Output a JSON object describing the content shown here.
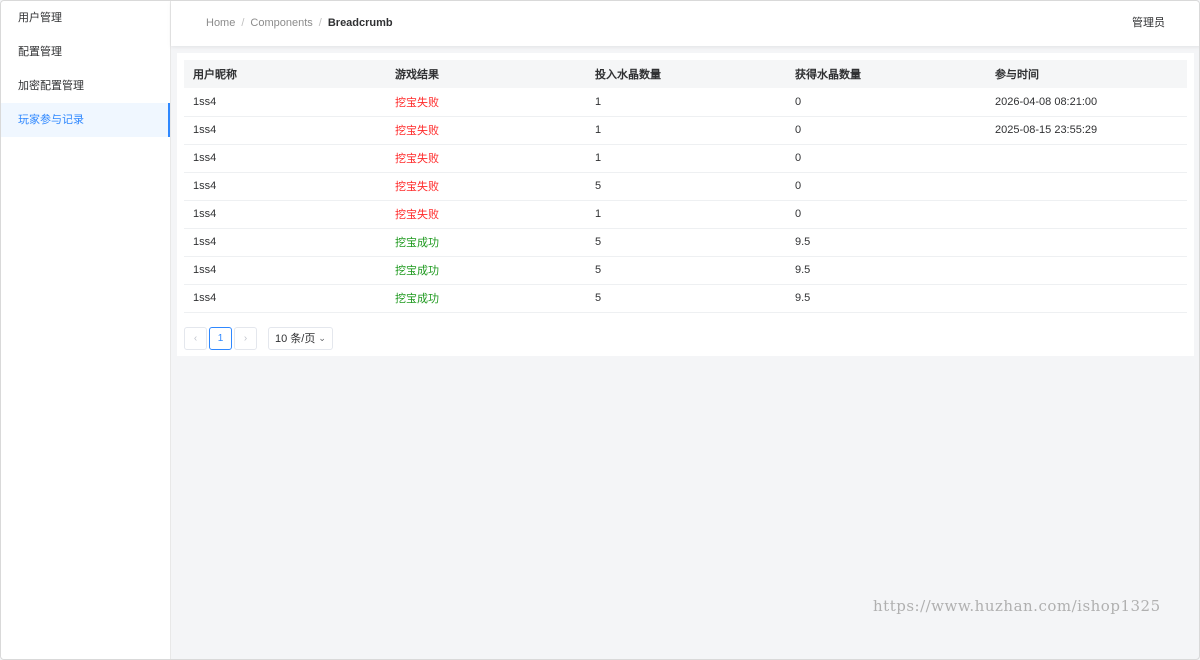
{
  "sidebar": {
    "items": [
      {
        "label": "用户管理"
      },
      {
        "label": "配置管理"
      },
      {
        "label": "加密配置管理"
      },
      {
        "label": "玩家参与记录"
      }
    ]
  },
  "header": {
    "breadcrumb": [
      "Home",
      "Components",
      "Breadcrumb"
    ],
    "user": "管理员"
  },
  "table": {
    "columns": [
      "用户昵称",
      "游戏结果",
      "投入水晶数量",
      "获得水晶数量",
      "参与时间"
    ],
    "rows": [
      [
        "1ss4",
        "挖宝失败",
        "1",
        "0",
        "2026-04-08 08:21:00"
      ],
      [
        "1ss4",
        "挖宝失败",
        "1",
        "0",
        "2025-08-15 23:55:29"
      ],
      [
        "1ss4",
        "挖宝失败",
        "1",
        "0",
        ""
      ],
      [
        "1ss4",
        "挖宝失败",
        "5",
        "0",
        ""
      ],
      [
        "1ss4",
        "挖宝失败",
        "1",
        "0",
        ""
      ],
      [
        "1ss4",
        "挖宝成功",
        "5",
        "9.5",
        ""
      ],
      [
        "1ss4",
        "挖宝成功",
        "5",
        "9.5",
        ""
      ],
      [
        "1ss4",
        "挖宝成功",
        "5",
        "9.5",
        ""
      ]
    ]
  },
  "pagination": {
    "prev": "‹",
    "current_page": "1",
    "next": "›",
    "page_size": "10 条/页",
    "page_size_chevron": "⌄"
  },
  "watermark": "https://www.huzhan.com/ishop1325",
  "colors": {
    "accent": "#2f88ff",
    "fail": "#ff2a2a",
    "success": "#1f9a1f"
  }
}
